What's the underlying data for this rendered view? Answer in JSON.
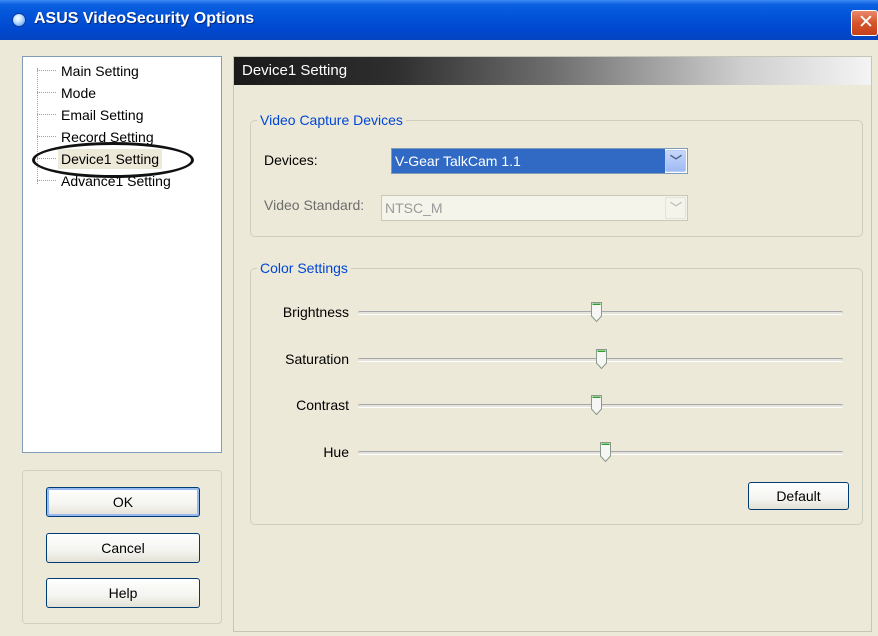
{
  "window": {
    "title": "ASUS VideoSecurity Options",
    "close_glyph": "✕"
  },
  "tree": {
    "items": [
      {
        "label": "Main Setting"
      },
      {
        "label": "Mode"
      },
      {
        "label": "Email Setting"
      },
      {
        "label": "Record Setting"
      },
      {
        "label": "Device1 Setting",
        "selected": true
      },
      {
        "label": "Advance1 Setting"
      }
    ]
  },
  "buttons": {
    "ok": "OK",
    "cancel": "Cancel",
    "help": "Help"
  },
  "panel": {
    "header": "Device1 Setting",
    "video_capture": {
      "legend": "Video Capture Devices",
      "devices_label": "Devices:",
      "devices_value": "V-Gear TalkCam 1.1",
      "standard_label": "Video Standard:",
      "standard_value": "NTSC_M"
    },
    "color_settings": {
      "legend": "Color Settings",
      "sliders": [
        {
          "label": "Brightness",
          "level": 0.49
        },
        {
          "label": "Saturation",
          "level": 0.5
        },
        {
          "label": "Contrast",
          "level": 0.49
        },
        {
          "label": "Hue",
          "level": 0.51
        }
      ],
      "default_button": "Default"
    }
  },
  "colors": {
    "titlebar": "#0353d8",
    "selection": "#316ac5",
    "legend_text": "#0046d5",
    "window_bg": "#ece9d8",
    "thumb_accent": "#2ea02e"
  },
  "icons": {
    "app": "app-orb-icon",
    "close": "close-icon",
    "dropdown": "chevron-down-icon"
  }
}
